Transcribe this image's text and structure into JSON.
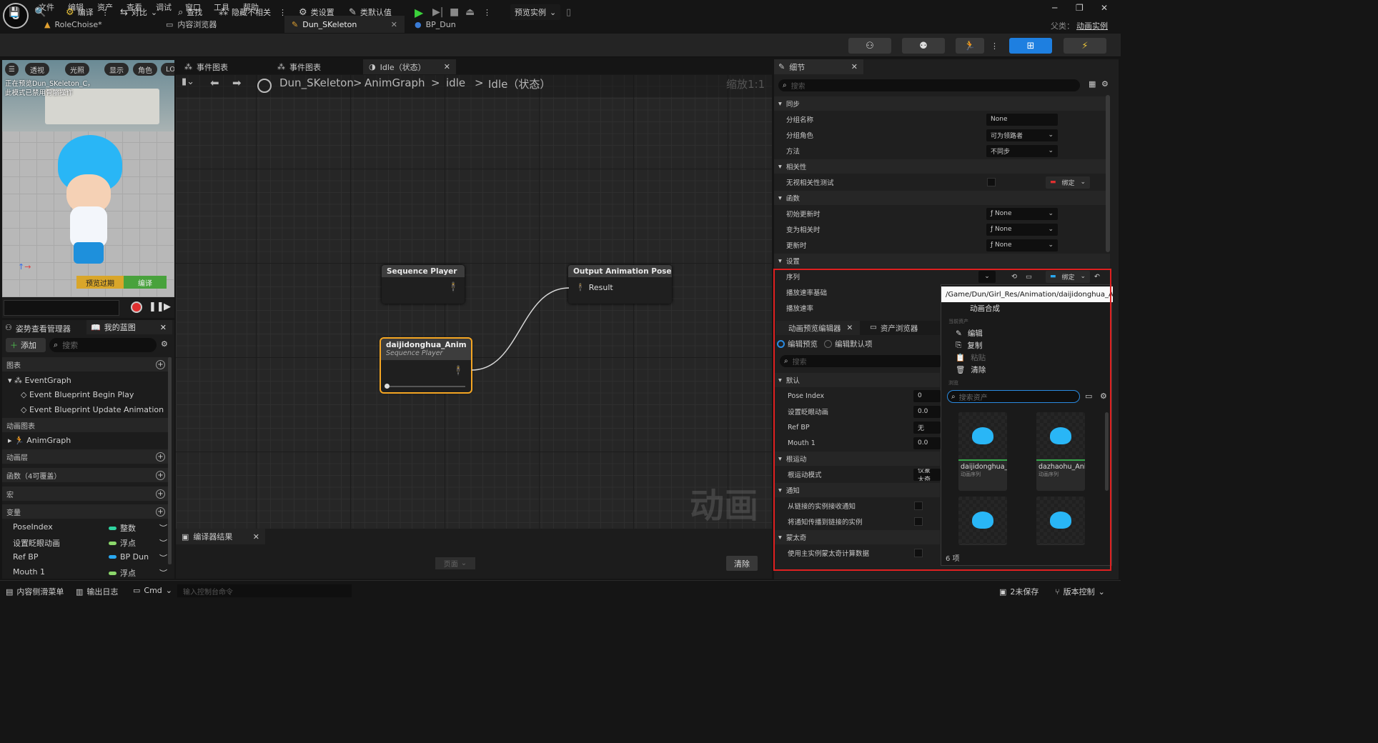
{
  "menu": [
    "文件",
    "编辑",
    "资产",
    "查看",
    "调试",
    "窗口",
    "工具",
    "帮助"
  ],
  "logo": "U",
  "doc_tabs": [
    {
      "label": "RoleChoise*"
    },
    {
      "label": "内容浏览器"
    },
    {
      "label": "Dun_SKeleton"
    },
    {
      "label": "BP_Dun"
    }
  ],
  "parent_label": "父类：",
  "parent_value": "动画实例",
  "toolbar": {
    "compile": "编译",
    "diff": "对比",
    "find": "查找",
    "hide_unrelated": "隐藏不相关",
    "class_settings": "类设置",
    "class_defaults": "类默认值",
    "preview_instance": "预览实例"
  },
  "viewport": {
    "btns": [
      "透视",
      "光照",
      "显示",
      "角色",
      "LO"
    ],
    "overlay_line1": "正在预览Dun_SKeleton_C，",
    "overlay_line2": "此模式已禁用骨骼操作",
    "preview_btn": "预览过期",
    "compile_btn": "编译"
  },
  "left_tabs": {
    "pose": "姿势查看管理器",
    "my_bp": "我的蓝图"
  },
  "my_bp": {
    "add": "添加",
    "search_placeholder": "搜索",
    "graphs": "图表",
    "event_graph": "EventGraph",
    "begin_play": "Event Blueprint Begin Play",
    "update_anim": "Event Blueprint Update Animation",
    "anim_graphs": "动画图表",
    "anim_graph": "AnimGraph",
    "anim_layers": "动画层",
    "functions": "函数（4可覆盖）",
    "macros": "宏",
    "variables": "变量"
  },
  "variables": [
    {
      "name": "PoseIndex",
      "type": "整数",
      "color": "#2fd4a0"
    },
    {
      "name": "设置眨眼动画",
      "type": "浮点",
      "color": "#8bd86b"
    },
    {
      "name": "Ref BP",
      "type": "BP Dun",
      "color": "#2aa8f0"
    },
    {
      "name": "Mouth 1",
      "type": "浮点",
      "color": "#8bd86b"
    }
  ],
  "graph_tabs": [
    "事件图表",
    "事件图表",
    "Idle（状态）"
  ],
  "breadcrumb": {
    "bp": "Dun_SKeleton",
    "sep": ">",
    "anim_graph": "AnimGraph",
    "idle": "idle",
    "state": "Idle（状态）",
    "zoom": "缩放1:1"
  },
  "nodes": {
    "seq_title": "Sequence Player",
    "output_title": "Output Animation Pose",
    "result": "Result",
    "anim_title": "daijidonghua_Anim",
    "anim_sub": "Sequence Player"
  },
  "watermark": "动画",
  "compiler": {
    "tab": "编译器结果",
    "page": "页面",
    "clear": "清除"
  },
  "details": {
    "tab": "细节",
    "search": "搜索",
    "sync": "同步",
    "group_name": "分组名称",
    "group_name_val": "None",
    "group_role": "分组角色",
    "group_role_val": "可为领路者",
    "method": "方法",
    "method_val": "不同步",
    "relevancy": "相关性",
    "ignore_rel": "无视相关性测试",
    "bind": "绑定",
    "functions": "函数",
    "init_update": "初始更新时",
    "become_rel": "变为相关时",
    "on_update": "更新时",
    "none": "None",
    "settings": "设置",
    "sequence": "序列",
    "play_rate_basis": "播放速率基础",
    "play_rate": "播放速率"
  },
  "preview_editor": {
    "tab1": "动画预览编辑器",
    "tab2": "资产浏览器",
    "edit_preview": "编辑预览",
    "edit_defaults": "编辑默认项",
    "search": "搜索",
    "default": "默认",
    "rows": [
      {
        "label": "Pose Index",
        "value": "0"
      },
      {
        "label": "设置眨眼动画",
        "value": "0.0"
      },
      {
        "label": "Ref BP",
        "value": "无"
      },
      {
        "label": "Mouth 1",
        "value": "0.0"
      }
    ],
    "root_motion": "根运动",
    "root_motion_mode": "根运动模式",
    "root_motion_val": "仅蒙太奇",
    "notify": "通知",
    "notify1": "从链接的实例接收通知",
    "notify2": "将通知传播到链接的实例",
    "montage": "蒙太奇",
    "montage1": "使用主实例蒙太奇计算数据"
  },
  "popup": {
    "path": "/Game/Dun/Girl_Res/Animation/daijidonghua_Anim",
    "anim_blend": "动画合成",
    "section_current": "当前资产",
    "edit": "编辑",
    "copy": "复制",
    "paste": "粘贴",
    "clear": "清除",
    "section_browse": "浏览",
    "search": "搜索资产",
    "count": "6 项",
    "assets": [
      {
        "name": "daijidonghua_Anim",
        "type": "动画序列"
      },
      {
        "name": "dazhaohu_Anim",
        "type": "动画序列"
      },
      {
        "name": "",
        "type": ""
      },
      {
        "name": "",
        "type": ""
      }
    ]
  },
  "status": {
    "drawer": "内容侧滑菜单",
    "log": "输出日志",
    "cmd": "Cmd",
    "console": "输入控制台命令",
    "save": "2未保存",
    "vc": "版本控制"
  }
}
